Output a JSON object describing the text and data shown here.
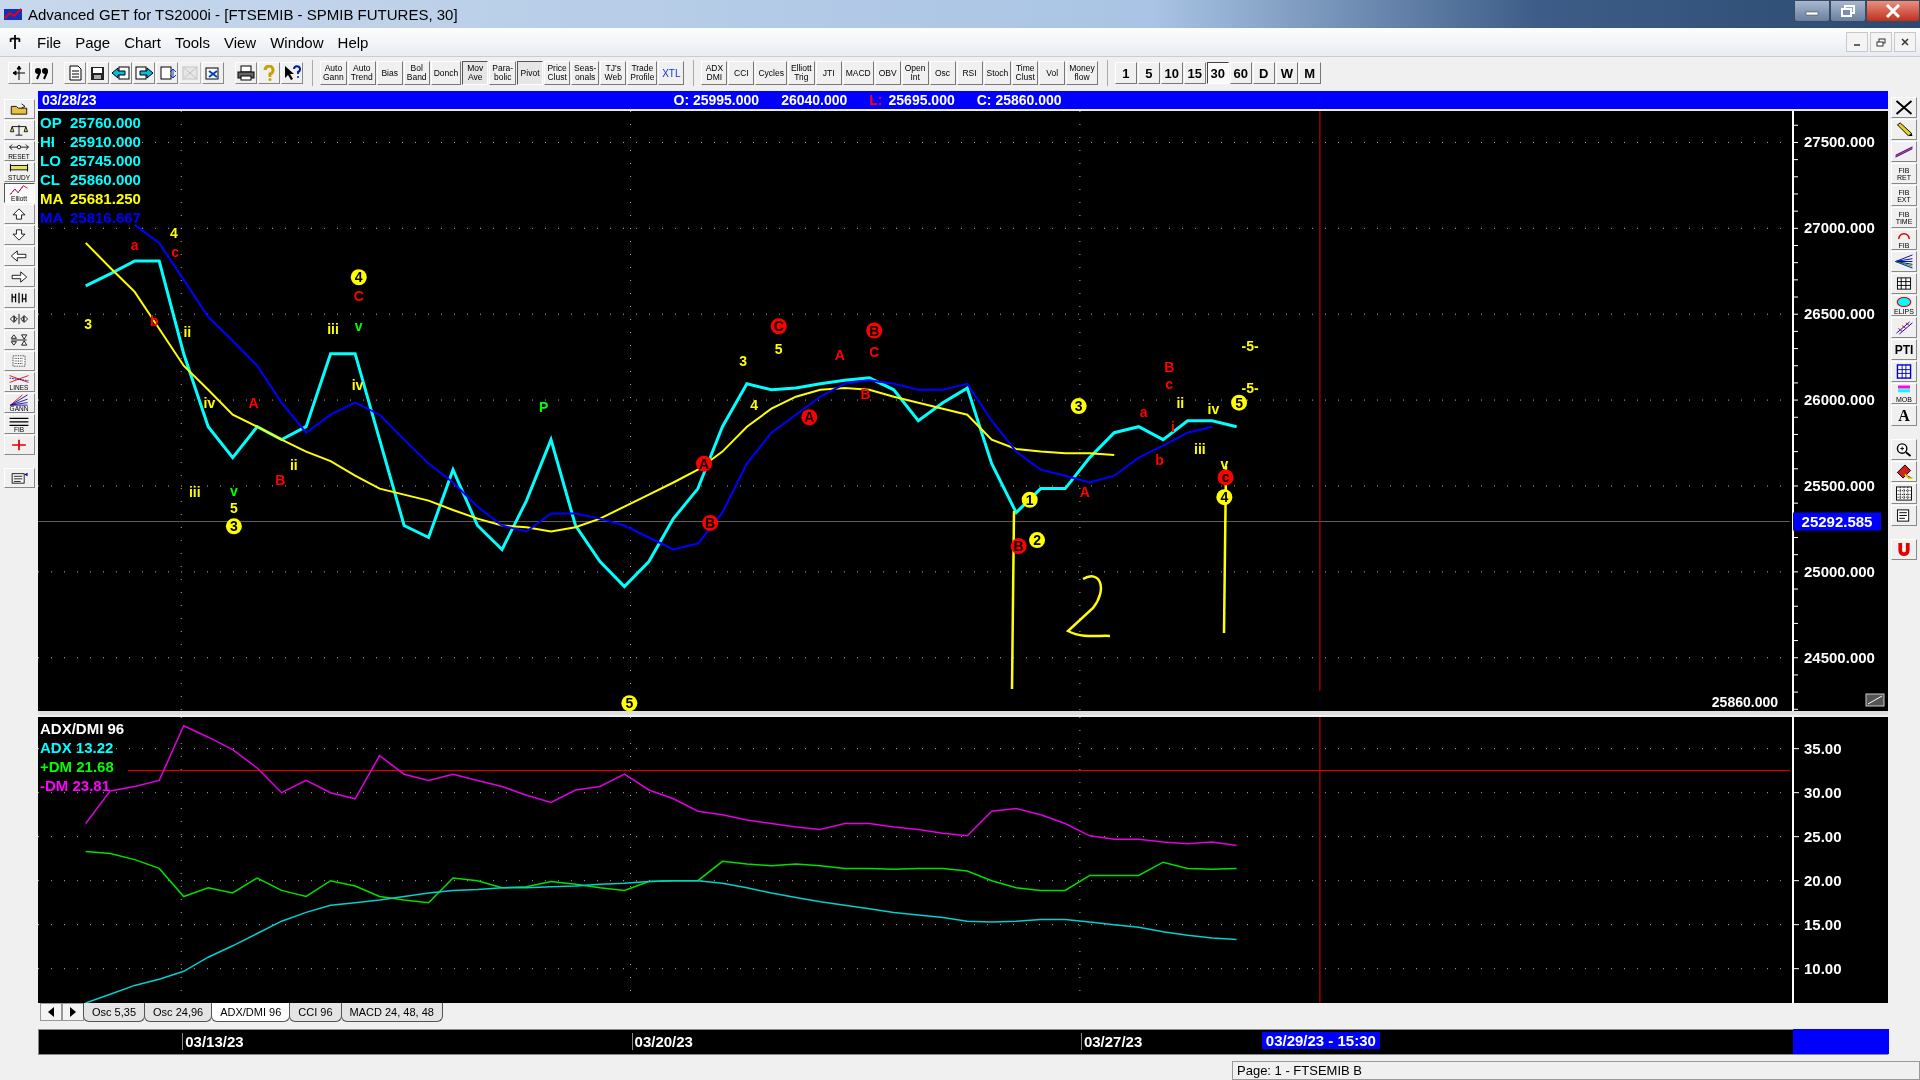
{
  "window": {
    "title": "Advanced GET for TS2000i - [FTSEMIB - SPMIB FUTURES, 30]"
  },
  "menu": [
    "File",
    "Page",
    "Chart",
    "Tools",
    "View",
    "Window",
    "Help"
  ],
  "toolbar": {
    "icon_buttons": [
      {
        "disabled": false
      },
      {
        "disabled": false
      },
      {
        "disabled": false
      },
      {
        "disabled": false
      },
      {
        "disabled": false
      },
      {
        "disabled": false
      },
      {
        "disabled": false
      },
      {
        "disabled": true
      },
      {
        "disabled": false
      },
      {
        "disabled": false
      },
      {
        "disabled": false
      },
      {
        "disabled": false
      }
    ],
    "study_buttons": [
      {
        "lines": [
          "Auto",
          "Gann"
        ],
        "selected": false
      },
      {
        "lines": [
          "Auto",
          "Trend"
        ],
        "selected": false
      },
      {
        "lines": [
          "Bias"
        ],
        "selected": false
      },
      {
        "lines": [
          "Bol",
          "Band"
        ],
        "selected": false
      },
      {
        "lines": [
          "Donch"
        ],
        "selected": false
      },
      {
        "lines": [
          "Mov",
          "Ave"
        ],
        "selected": true
      },
      {
        "lines": [
          "Para-",
          "bolic"
        ],
        "selected": false
      },
      {
        "lines": [
          "Pivot"
        ],
        "selected": true
      },
      {
        "lines": [
          "Price",
          "Clust"
        ],
        "selected": false
      },
      {
        "lines": [
          "Seas-",
          "onals"
        ],
        "selected": false
      },
      {
        "lines": [
          "TJ's",
          "Web"
        ],
        "selected": false
      },
      {
        "lines": [
          "Trade",
          "Profile"
        ],
        "selected": false
      },
      {
        "lines": [
          "XTL"
        ],
        "selected": false
      }
    ],
    "indicator_buttons": [
      {
        "lines": [
          "ADX",
          "DMI"
        ],
        "selected": false
      },
      {
        "lines": [
          "CCI"
        ],
        "selected": false
      },
      {
        "lines": [
          "Cycles"
        ],
        "selected": false
      },
      {
        "lines": [
          "Elliott",
          "Trig"
        ],
        "selected": false
      },
      {
        "lines": [
          "JTI"
        ],
        "selected": false
      },
      {
        "lines": [
          "MACD"
        ],
        "selected": false
      },
      {
        "lines": [
          "OBV"
        ],
        "selected": false
      },
      {
        "lines": [
          "Open",
          "Int"
        ],
        "selected": false
      },
      {
        "lines": [
          "Osc"
        ],
        "selected": false
      },
      {
        "lines": [
          "RSI"
        ],
        "selected": false
      },
      {
        "lines": [
          "Stoch"
        ],
        "selected": false
      },
      {
        "lines": [
          "Time",
          "Clust"
        ],
        "selected": false
      },
      {
        "lines": [
          "Vol"
        ],
        "selected": false
      },
      {
        "lines": [
          "Money",
          "flow"
        ],
        "selected": false
      }
    ],
    "interval_buttons": [
      {
        "label": "1",
        "selected": false
      },
      {
        "label": "5",
        "selected": false
      },
      {
        "label": "10",
        "selected": false
      },
      {
        "label": "15",
        "selected": false
      },
      {
        "label": "30",
        "selected": true
      },
      {
        "label": "60",
        "selected": false
      },
      {
        "label": "D",
        "selected": false
      },
      {
        "label": "W",
        "selected": false
      },
      {
        "label": "M",
        "selected": false
      }
    ]
  },
  "left_toolbar": [
    {
      "selected": false
    },
    {
      "selected": false
    },
    {
      "label": "RESET",
      "selected": false
    },
    {
      "label": "STUDY",
      "selected": false
    },
    {
      "label": "Elliott",
      "selected": true
    },
    {
      "selected": false
    },
    {
      "selected": false
    },
    {
      "selected": false
    },
    {
      "selected": false
    },
    {
      "selected": false
    },
    {
      "selected": false
    },
    {
      "selected": false
    },
    {
      "selected": false
    },
    {
      "label": "LINES",
      "selected": false
    },
    {
      "label": "GANN",
      "selected": false
    },
    {
      "label": "FIB",
      "selected": false
    },
    {
      "selected": false
    },
    {
      "selected": false
    }
  ],
  "right_toolbar": [
    {
      "selected": false
    },
    {
      "selected": false
    },
    {
      "selected": false
    },
    {
      "lines": [
        "FIB",
        "RET"
      ],
      "selected": false
    },
    {
      "lines": [
        "FIB",
        "EXT"
      ],
      "selected": false
    },
    {
      "lines": [
        "FIB",
        "TIME"
      ],
      "selected": false
    },
    {
      "lines": [
        "FIB"
      ],
      "selected": false
    },
    {
      "selected": false
    },
    {
      "selected": false
    },
    {
      "lines": [
        "ELIPS"
      ],
      "selected": false
    },
    {
      "selected": false
    },
    {
      "lines": [
        "PTI"
      ],
      "selected": false
    },
    {
      "selected": false
    },
    {
      "lines": [
        "MOB"
      ],
      "selected": false
    },
    {
      "lines": [
        "A"
      ],
      "selected": false
    },
    {
      "selected": false
    },
    {
      "selected": false
    },
    {
      "selected": false
    },
    {
      "selected": false
    },
    {
      "selected": false
    }
  ],
  "price_pane": {
    "date": "03/28/23",
    "readouts": [
      {
        "text": "O: 25995.000"
      },
      {
        "text": "26040.000"
      },
      {
        "label": "L:",
        "text": "25695.000"
      },
      {
        "text": "C: 25860.000"
      }
    ],
    "legend": [
      {
        "label": "OP",
        "value": "25760.000",
        "color": "#00ffff"
      },
      {
        "label": "HI",
        "value": "25910.000",
        "color": "#00ffff"
      },
      {
        "label": "LO",
        "value": "25745.000",
        "color": "#00ffff"
      },
      {
        "label": "CL",
        "value": "25860.000",
        "color": "#00ffff"
      },
      {
        "label": "MA",
        "value": "25681.250",
        "color": "#ffff00"
      },
      {
        "label": "MA",
        "value": "25816.667",
        "color": "#0000ff"
      }
    ],
    "last_value": "25860.000",
    "cursor_value": "25292.585",
    "wave_labels": [
      {
        "text": "3",
        "color": "#ffff00",
        "circled": false
      },
      {
        "text": "a",
        "color": "#ff0000",
        "circled": false
      },
      {
        "text": "b",
        "color": "#ff0000",
        "circled": false
      },
      {
        "text": "4",
        "color": "#ffff00",
        "circled": false
      },
      {
        "text": "c",
        "color": "#ff0000",
        "circled": false
      },
      {
        "text": "ii",
        "color": "#ffff00",
        "circled": false
      },
      {
        "text": "iii",
        "color": "#ffff00",
        "circled": false
      },
      {
        "text": "iv",
        "color": "#ffff00",
        "circled": false
      },
      {
        "text": "v",
        "color": "#00ff00",
        "circled": false
      },
      {
        "text": "5",
        "color": "#ffff00",
        "circled": false
      },
      {
        "text": "3",
        "color": "#ffff00",
        "circled": true
      },
      {
        "text": "A",
        "color": "#ff0000",
        "circled": false
      },
      {
        "text": "B",
        "color": "#ff0000",
        "circled": false
      },
      {
        "text": "ii",
        "color": "#ffff00",
        "circled": false
      },
      {
        "text": "iii",
        "color": "#ffff00",
        "circled": false
      },
      {
        "text": "4",
        "color": "#ffff00",
        "circled": true
      },
      {
        "text": "C",
        "color": "#ff0000",
        "circled": false
      },
      {
        "text": "v",
        "color": "#00ff00",
        "circled": false
      },
      {
        "text": "iv",
        "color": "#ffff00",
        "circled": false
      },
      {
        "text": "P",
        "color": "#00ff00",
        "circled": false
      },
      {
        "text": "5",
        "color": "#ffff00",
        "circled": true
      },
      {
        "text": "A",
        "color": "#ff0000",
        "circled": true
      },
      {
        "text": "B",
        "color": "#ff0000",
        "circled": true
      },
      {
        "text": "3",
        "color": "#ffff00",
        "circled": false
      },
      {
        "text": "4",
        "color": "#ffff00",
        "circled": false
      },
      {
        "text": "C",
        "color": "#ff0000",
        "circled": true
      },
      {
        "text": "5",
        "color": "#ffff00",
        "circled": false
      },
      {
        "text": "A",
        "color": "#ff0000",
        "circled": true
      },
      {
        "text": "A",
        "color": "#ff0000",
        "circled": false
      },
      {
        "text": "B",
        "color": "#ff0000",
        "circled": false
      },
      {
        "text": "B",
        "color": "#ff0000",
        "circled": true
      },
      {
        "text": "C",
        "color": "#ff0000",
        "circled": false
      },
      {
        "text": "B",
        "color": "#ff0000",
        "circled": true
      },
      {
        "text": "1",
        "color": "#ffff00",
        "circled": true
      },
      {
        "text": "2",
        "color": "#ffff00",
        "circled": true
      },
      {
        "text": "3",
        "color": "#ffff00",
        "circled": true
      },
      {
        "text": "A",
        "color": "#ff0000",
        "circled": false
      },
      {
        "text": "a",
        "color": "#ff0000",
        "circled": false
      },
      {
        "text": "b",
        "color": "#ff0000",
        "circled": false
      },
      {
        "text": "B",
        "color": "#ff0000",
        "circled": false
      },
      {
        "text": "c",
        "color": "#ff0000",
        "circled": false
      },
      {
        "text": "ii",
        "color": "#ffff00",
        "circled": false
      },
      {
        "text": "i",
        "color": "#ff0000",
        "circled": false
      },
      {
        "text": "iii",
        "color": "#ffff00",
        "circled": false
      },
      {
        "text": "iv",
        "color": "#ffff00",
        "circled": false
      },
      {
        "text": "5",
        "color": "#ffff00",
        "circled": true
      },
      {
        "text": "v",
        "color": "#ffff00",
        "circled": false
      },
      {
        "text": "c",
        "color": "#ff0000",
        "circled": true
      },
      {
        "text": "4",
        "color": "#ffff00",
        "circled": true
      },
      {
        "text": "-5-",
        "color": "#ffff00",
        "circled": false
      },
      {
        "text": "-5-",
        "color": "#ffff00",
        "circled": false
      }
    ],
    "chart_data": {
      "type": "line",
      "grid": true,
      "ylim": [
        24190,
        27683
      ],
      "ref_lines": [
        {
          "axis": "y",
          "value": 25293,
          "color": "#606060"
        }
      ],
      "yticks": [
        {
          "value": 24500,
          "label": "24500.000"
        },
        {
          "value": 25000,
          "label": "25000.000"
        },
        {
          "value": 25500,
          "label": "25500.000"
        },
        {
          "value": 26000,
          "label": "26000.000"
        },
        {
          "value": 26500,
          "label": "26500.000"
        },
        {
          "value": 27000,
          "label": "27000.000"
        },
        {
          "value": 27500,
          "label": "27500.000"
        }
      ],
      "series": [
        {
          "color": "#00ffff",
          "values": [
            26665,
            26735,
            26810,
            26810,
            26270,
            25845,
            25665,
            25845,
            25770,
            25845,
            26270,
            26270,
            25770,
            25270,
            25200,
            25595,
            25270,
            25130,
            25415,
            25770,
            25270,
            25060,
            24915,
            25060,
            25310,
            25485,
            25845,
            26095,
            26060,
            26070,
            26095,
            26115,
            26130,
            26060,
            25880,
            25985,
            26070,
            25630,
            25345,
            25485,
            25485,
            25665,
            25810,
            25845,
            25770,
            25880,
            25880,
            25845
          ]
        },
        {
          "color": "#ffff00",
          "values": [
            26915,
            26770,
            26630,
            26415,
            26200,
            26060,
            25915,
            25845,
            25770,
            25700,
            25645,
            25560,
            25485,
            25450,
            25415,
            25360,
            25310,
            25270,
            25260,
            25235,
            25260,
            25310,
            25380,
            25450,
            25520,
            25595,
            25700,
            25845,
            25950,
            26020,
            26060,
            26070,
            26060,
            26020,
            25985,
            25950,
            25915,
            25770,
            25715,
            25700,
            25690,
            25690,
            25680,
            null,
            null,
            null,
            null,
            null
          ]
        },
        {
          "color": "#0000ff",
          "values": [
            null,
            null,
            27020,
            26915,
            26700,
            26485,
            26345,
            26200,
            25985,
            25810,
            25915,
            25985,
            25915,
            25770,
            25630,
            25520,
            25380,
            25270,
            25235,
            25340,
            25340,
            25310,
            25270,
            25200,
            25130,
            25165,
            25345,
            25630,
            25810,
            25915,
            26020,
            26095,
            26115,
            26095,
            26060,
            26060,
            26095,
            25880,
            25700,
            25595,
            25560,
            25520,
            25560,
            25665,
            25735,
            25810,
            25845,
            null
          ]
        }
      ]
    }
  },
  "indicator_pane": {
    "legend": [
      {
        "text": "ADX/DMI 96",
        "color": "#ffffff"
      },
      {
        "text": "ADX 13.22",
        "color": "#00ffff"
      },
      {
        "text": "+DM 21.68",
        "color": "#00ff00"
      },
      {
        "text": "-DM  23.81",
        "color": "#ff00ff"
      }
    ],
    "chart_data": {
      "type": "line",
      "grid": true,
      "ylim": [
        6.1,
        38.6
      ],
      "ref_lines": [
        {
          "axis": "y",
          "value": 32.5,
          "color": "#ff0000"
        }
      ],
      "yticks": [
        {
          "value": 10,
          "label": "10.00"
        },
        {
          "value": 15,
          "label": "15.00"
        },
        {
          "value": 20,
          "label": "20.00"
        },
        {
          "value": 25,
          "label": "25.00"
        },
        {
          "value": 30,
          "label": "30.00"
        },
        {
          "value": 35,
          "label": "35.00"
        }
      ],
      "series": [
        {
          "color": "#e000e0",
          "values": [
            26.5,
            30.2,
            30.7,
            31.4,
            37.6,
            36.3,
            34.9,
            32.8,
            30.0,
            31.4,
            30.0,
            29.3,
            34.2,
            32.1,
            31.4,
            32.1,
            31.4,
            30.7,
            29.7,
            28.9,
            30.3,
            30.7,
            32.1,
            30.3,
            29.3,
            27.9,
            27.5,
            26.9,
            26.5,
            26.1,
            25.8,
            26.5,
            26.5,
            26.1,
            25.8,
            25.4,
            25.1,
            27.9,
            28.2,
            27.5,
            26.5,
            25.1,
            24.7,
            24.7,
            24.4,
            24.2,
            24.4,
            24.0
          ]
        },
        {
          "color": "#00e000",
          "values": [
            23.3,
            23.1,
            22.4,
            21.4,
            18.2,
            19.2,
            18.6,
            20.3,
            18.9,
            18.2,
            20.0,
            19.4,
            18.2,
            17.8,
            17.5,
            20.3,
            20.0,
            19.2,
            19.3,
            19.9,
            19.6,
            19.2,
            18.9,
            19.9,
            20.0,
            20.0,
            22.2,
            21.9,
            21.7,
            21.9,
            21.7,
            21.4,
            21.4,
            21.3,
            21.4,
            21.4,
            21.1,
            20.0,
            19.2,
            18.9,
            18.9,
            20.6,
            20.6,
            20.6,
            22.1,
            21.4,
            21.3,
            21.4
          ]
        },
        {
          "color": "#00d0d0",
          "values": [
            6.1,
            7.1,
            8.1,
            8.8,
            9.7,
            11.3,
            12.6,
            14.0,
            15.4,
            16.4,
            17.2,
            17.5,
            17.8,
            18.2,
            18.6,
            18.9,
            19.0,
            19.2,
            19.2,
            19.3,
            19.4,
            19.6,
            19.7,
            19.9,
            20.0,
            20.0,
            19.7,
            19.2,
            18.6,
            18.1,
            17.6,
            17.2,
            16.8,
            16.4,
            16.1,
            15.8,
            15.4,
            15.3,
            15.4,
            15.6,
            15.6,
            15.3,
            15.0,
            14.7,
            14.2,
            13.8,
            13.5,
            13.3
          ]
        }
      ]
    }
  },
  "indicator_tabs": [
    {
      "label": "Osc 5,35",
      "selected": false
    },
    {
      "label": "Osc 24,96",
      "selected": false
    },
    {
      "label": "ADX/DMI 96",
      "selected": true
    },
    {
      "label": "CCI 96",
      "selected": false
    },
    {
      "label": "MACD 24, 48, 48",
      "selected": false
    }
  ],
  "time_axis": {
    "dates": [
      "03/13/23",
      "03/20/23",
      "03/27/23"
    ],
    "cursor": "03/29/23 - 15:30"
  },
  "status_bar": {
    "text": "Page: 1 - FTSEMIB B"
  }
}
